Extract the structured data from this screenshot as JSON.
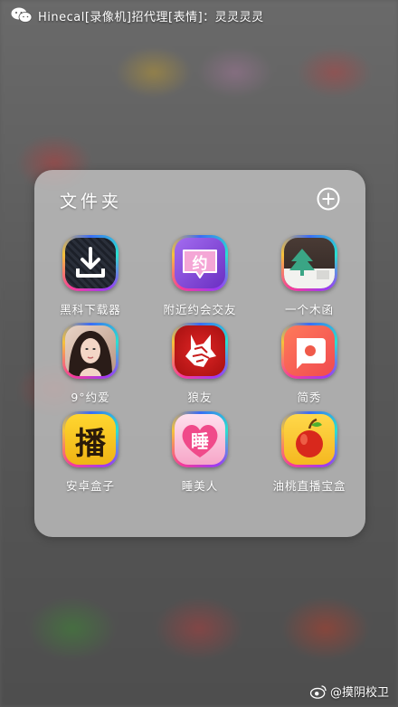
{
  "status_bar": {
    "notification_app_icon": "wechat-icon",
    "notification_text": "Hinecal[录像机]招代理[表情]：灵灵灵灵"
  },
  "folder": {
    "title": "文件夹",
    "add_icon": "plus-circle-icon",
    "apps": [
      {
        "label": "黑科下载器",
        "icon": "download-tray-icon",
        "color": "#1f2833"
      },
      {
        "label": "附近约会交友",
        "icon": "purple-chat-bubble-icon",
        "icon_text": "约",
        "color": "#8a3fd6"
      },
      {
        "label": "一个木函",
        "icon": "tree-box-icon",
        "color": "#2a7a55"
      },
      {
        "label": "9°约爱",
        "icon": "portrait-photo-icon",
        "color": "#9a6a5a"
      },
      {
        "label": "狼友",
        "icon": "wolf-head-icon",
        "color": "#c61a1a"
      },
      {
        "label": "简秀",
        "icon": "play-bubble-icon",
        "color": "#f05a4a"
      },
      {
        "label": "安卓盒子",
        "icon": "broadcast-char-icon",
        "icon_text": "播",
        "color": "#f2c21a"
      },
      {
        "label": "睡美人",
        "icon": "pink-heart-icon",
        "icon_text": "睡",
        "color": "#f06aa0"
      },
      {
        "label": "油桃直播宝盒",
        "icon": "nectarine-fruit-icon",
        "color": "#ffcc30"
      }
    ]
  },
  "watermark": {
    "icon": "weibo-icon",
    "text": "@摸阴校卫"
  }
}
